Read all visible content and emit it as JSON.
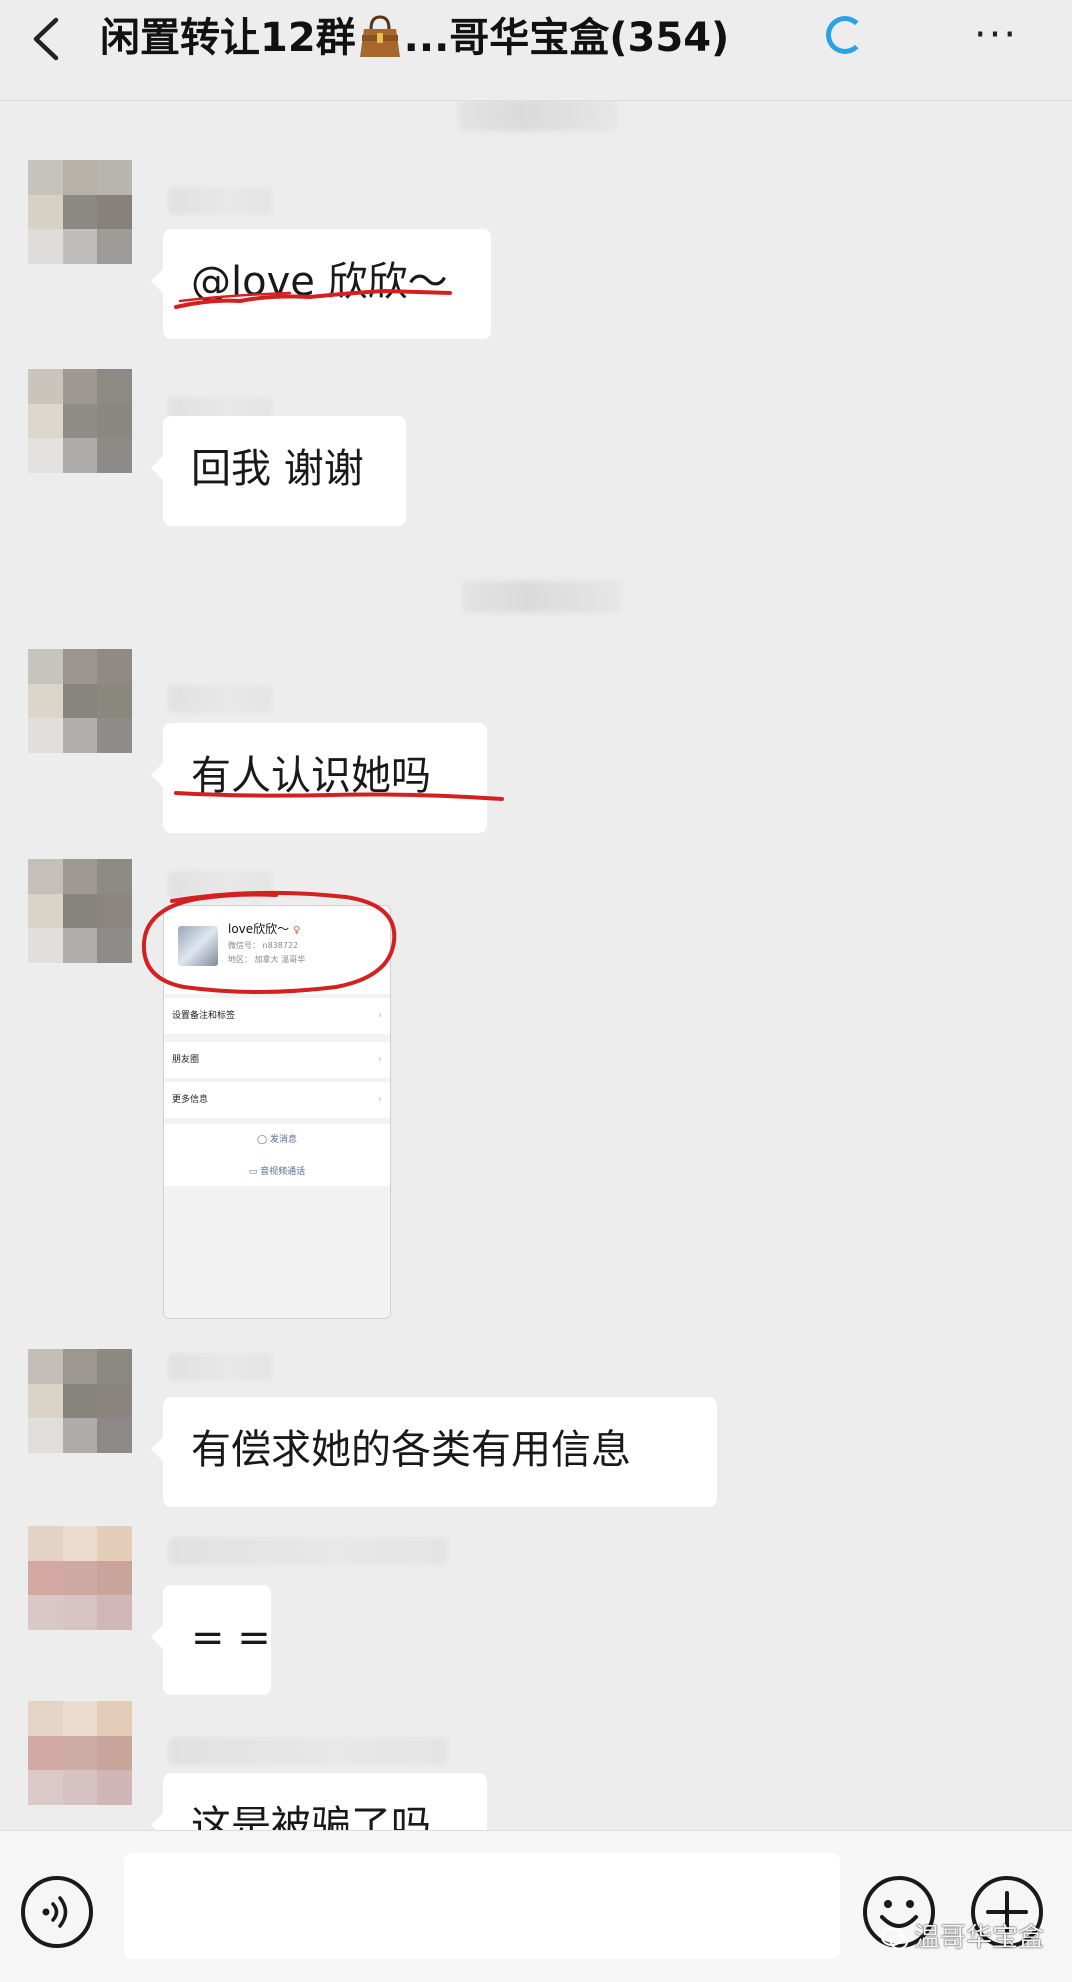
{
  "header": {
    "title_prefix": "闲置转让12群",
    "title_suffix": "...哥华宝盒(354)",
    "bag_icon": "handbag-emoji-icon",
    "back_icon": "chevron-left-icon",
    "loading_icon": "spinner-icon",
    "more_icon": "more-dots-icon",
    "more_glyph": "···"
  },
  "messages": [
    {
      "text": "@love 欣欣～",
      "annotated": "red-underline"
    },
    {
      "text": "回我 谢谢"
    },
    {
      "text": "有人认识她吗",
      "annotated": "red-underline"
    },
    {
      "type": "image",
      "annotated": "red-circle",
      "profile": {
        "name": "love欣欣～",
        "gender_icon": "female-icon",
        "gender_glyph": "♀",
        "wechat_id": "微信号： n838722",
        "region": "地区： 加拿大 温哥华"
      },
      "rows": [
        "设置备注和标签",
        "朋友圈",
        "更多信息"
      ],
      "actions": [
        "发消息",
        "音视频通话"
      ]
    },
    {
      "text": "有偿求她的各类有用信息"
    },
    {
      "text": "= ="
    },
    {
      "text": "这是被骗了吗"
    }
  ],
  "bottom": {
    "voice_icon": "voice-icon",
    "emoji_icon": "emoji-icon",
    "plus_icon": "plus-icon",
    "watermark": "温哥华宝盒"
  },
  "colors": {
    "background": "#ededed",
    "bubble": "#ffffff",
    "annotation_red": "#d42020",
    "spinner": "#2aa3e0",
    "link": "#576b95"
  }
}
